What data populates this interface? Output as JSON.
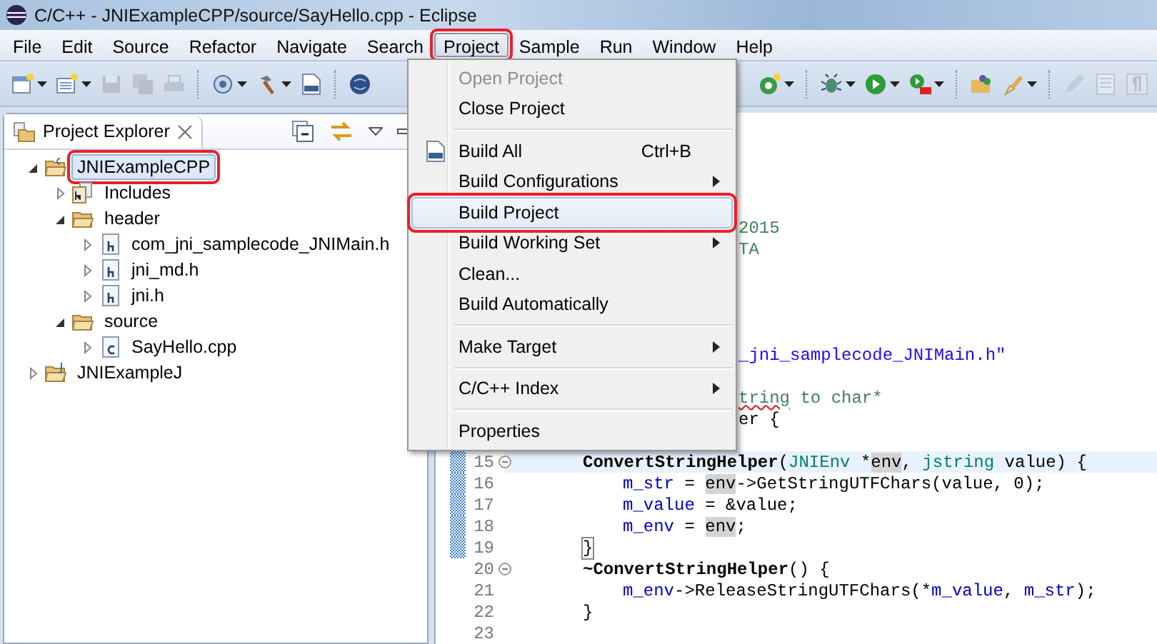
{
  "window": {
    "title": "C/C++ - JNIExampleCPP/source/SayHello.cpp - Eclipse"
  },
  "menu_bar": [
    {
      "label": "File",
      "selected": false,
      "callout": false
    },
    {
      "label": "Edit",
      "selected": false,
      "callout": false
    },
    {
      "label": "Source",
      "selected": false,
      "callout": false
    },
    {
      "label": "Refactor",
      "selected": false,
      "callout": false
    },
    {
      "label": "Navigate",
      "selected": false,
      "callout": false
    },
    {
      "label": "Search",
      "selected": false,
      "callout": false
    },
    {
      "label": "Project",
      "selected": true,
      "callout": true
    },
    {
      "label": "Sample",
      "selected": false,
      "callout": false
    },
    {
      "label": "Run",
      "selected": false,
      "callout": false
    },
    {
      "label": "Window",
      "selected": false,
      "callout": false
    },
    {
      "label": "Help",
      "selected": false,
      "callout": false
    }
  ],
  "toolbar_left": [
    {
      "kind": "new",
      "dropdown": true,
      "disabled": false
    },
    {
      "kind": "new-class",
      "dropdown": true,
      "disabled": false
    },
    {
      "kind": "save",
      "dropdown": false,
      "disabled": true
    },
    {
      "kind": "save-all",
      "dropdown": false,
      "disabled": true
    },
    {
      "kind": "print",
      "dropdown": false,
      "disabled": true
    },
    {
      "kind": "separator"
    },
    {
      "kind": "debug-config",
      "dropdown": true,
      "disabled": false
    },
    {
      "kind": "hammer",
      "dropdown": true,
      "disabled": false
    },
    {
      "kind": "binary",
      "dropdown": false,
      "disabled": false
    },
    {
      "kind": "separator"
    },
    {
      "kind": "globe",
      "dropdown": false,
      "disabled": false
    }
  ],
  "toolbar_right": [
    {
      "kind": "new-c",
      "dropdown": true,
      "disabled": false
    },
    {
      "kind": "separator"
    },
    {
      "kind": "bug",
      "dropdown": true,
      "disabled": false
    },
    {
      "kind": "run",
      "dropdown": true,
      "disabled": false
    },
    {
      "kind": "run-external",
      "dropdown": true,
      "disabled": false
    },
    {
      "kind": "separator"
    },
    {
      "kind": "open-folder",
      "dropdown": false,
      "disabled": false
    },
    {
      "kind": "brush",
      "dropdown": true,
      "disabled": false
    },
    {
      "kind": "separator"
    },
    {
      "kind": "pencil",
      "dropdown": false,
      "disabled": true
    },
    {
      "kind": "page",
      "dropdown": false,
      "disabled": true
    },
    {
      "kind": "pilcrow",
      "dropdown": false,
      "disabled": true
    }
  ],
  "project_explorer": {
    "title": "Project Explorer",
    "tree": [
      {
        "label": "JNIExampleCPP",
        "kind": "c-project",
        "expanded": true,
        "selected": true,
        "callout": true,
        "children": [
          {
            "label": "Includes",
            "kind": "includes",
            "expanded": false,
            "selected": false,
            "callout": false
          },
          {
            "label": "header",
            "kind": "folder",
            "expanded": true,
            "selected": false,
            "callout": false,
            "children": [
              {
                "label": "com_jni_samplecode_JNIMain.h",
                "kind": "header-file",
                "expanded": false,
                "selected": false,
                "callout": false
              },
              {
                "label": "jni_md.h",
                "kind": "header-file",
                "expanded": false,
                "selected": false,
                "callout": false
              },
              {
                "label": "jni.h",
                "kind": "header-file",
                "expanded": false,
                "selected": false,
                "callout": false
              }
            ]
          },
          {
            "label": "source",
            "kind": "folder",
            "expanded": true,
            "selected": false,
            "callout": false,
            "children": [
              {
                "label": "SayHello.cpp",
                "kind": "source-file",
                "expanded": false,
                "selected": false,
                "callout": false
              }
            ]
          }
        ]
      },
      {
        "label": "JNIExampleJ",
        "kind": "java-project",
        "expanded": false,
        "selected": false,
        "callout": false
      }
    ]
  },
  "project_menu": [
    {
      "kind": "item",
      "label": "Open Project",
      "disabled": true,
      "selected": false,
      "callout": false
    },
    {
      "kind": "item",
      "label": "Close Project",
      "disabled": false,
      "selected": false,
      "callout": false
    },
    {
      "kind": "separator"
    },
    {
      "kind": "icon-item",
      "label": "Build All",
      "shortcut": "Ctrl+B",
      "disabled": false,
      "selected": false,
      "callout": false
    },
    {
      "kind": "item",
      "label": "Build Configurations",
      "submenu": true,
      "disabled": false,
      "selected": false,
      "callout": false
    },
    {
      "kind": "item",
      "label": "Build Project",
      "disabled": false,
      "selected": true,
      "callout": true
    },
    {
      "kind": "item",
      "label": "Build Working Set",
      "submenu": true,
      "disabled": false,
      "selected": false,
      "callout": false
    },
    {
      "kind": "item",
      "label": "Clean...",
      "disabled": false,
      "selected": false,
      "callout": false
    },
    {
      "kind": "item",
      "label": "Build Automatically",
      "disabled": false,
      "selected": false,
      "callout": false
    },
    {
      "kind": "separator"
    },
    {
      "kind": "item",
      "label": "Make Target",
      "submenu": true,
      "disabled": false,
      "selected": false,
      "callout": false
    },
    {
      "kind": "separator"
    },
    {
      "kind": "item",
      "label": "C/C++ Index",
      "submenu": true,
      "disabled": false,
      "selected": false,
      "callout": false
    },
    {
      "kind": "separator"
    },
    {
      "kind": "item",
      "label": "Properties",
      "disabled": false,
      "selected": false,
      "callout": false
    }
  ],
  "editor": {
    "covered_lines": [
      {
        "kind": "blank"
      },
      {
        "kind": "blank"
      },
      {
        "kind": "blank"
      },
      {
        "kind": "fragment",
        "segments": [
          {
            "text": "2015",
            "kind": "comment"
          }
        ]
      },
      {
        "kind": "fragment",
        "segments": [
          {
            "text": "TA",
            "kind": "comment"
          }
        ]
      },
      {
        "kind": "blank"
      },
      {
        "kind": "blank"
      },
      {
        "kind": "blank"
      },
      {
        "kind": "blank"
      },
      {
        "kind": "fragment",
        "segments": [
          {
            "text": "_jni_samplecode_JNIMain.h\"",
            "kind": "string"
          }
        ]
      },
      {
        "kind": "blank"
      },
      {
        "kind": "fragment",
        "segments": [
          {
            "text": "tring",
            "kind": "comment-typo"
          },
          {
            "text": " to char*",
            "kind": "comment"
          }
        ]
      },
      {
        "kind": "fragment",
        "segments": [
          {
            "text": "er {",
            "kind": "plain"
          }
        ]
      },
      {
        "kind": "blank"
      }
    ],
    "lines": [
      {
        "number": "15",
        "fold": true,
        "changed": true,
        "current": true,
        "segments": [
          {
            "text": "ConvertStringHelper",
            "kind": "bold"
          },
          {
            "text": "(",
            "kind": "plain"
          },
          {
            "text": "JNIEnv",
            "kind": "type"
          },
          {
            "text": " *",
            "kind": "plain"
          },
          {
            "text": "env",
            "kind": "mark"
          },
          {
            "text": ", ",
            "kind": "plain"
          },
          {
            "text": "jstring",
            "kind": "type"
          },
          {
            "text": " value) {",
            "kind": "plain"
          }
        ],
        "children": [
          {
            "number": "16",
            "fold": false,
            "changed": true,
            "current": false,
            "segments": [
              {
                "text": "m_str",
                "kind": "field"
              },
              {
                "text": " = ",
                "kind": "plain"
              },
              {
                "text": "env",
                "kind": "mark"
              },
              {
                "text": "->GetStringUTFChars(value, 0);",
                "kind": "plain"
              }
            ]
          },
          {
            "number": "17",
            "fold": false,
            "changed": true,
            "current": false,
            "segments": [
              {
                "text": "m_value",
                "kind": "field"
              },
              {
                "text": " = &value;",
                "kind": "plain"
              }
            ]
          },
          {
            "number": "18",
            "fold": false,
            "changed": true,
            "current": false,
            "segments": [
              {
                "text": "m_env",
                "kind": "field"
              },
              {
                "text": " = ",
                "kind": "plain"
              },
              {
                "text": "env",
                "kind": "mark"
              },
              {
                "text": ";",
                "kind": "plain"
              }
            ]
          }
        ]
      },
      {
        "number": "19",
        "fold": false,
        "changed": true,
        "current": false,
        "segments": [
          {
            "text": "}",
            "kind": "bracket-match"
          }
        ]
      },
      {
        "number": "20",
        "fold": true,
        "changed": false,
        "current": false,
        "segments": [
          {
            "text": "~ConvertStringHelper",
            "kind": "bold"
          },
          {
            "text": "() {",
            "kind": "plain"
          }
        ],
        "children": [
          {
            "number": "21",
            "fold": false,
            "changed": false,
            "current": false,
            "segments": [
              {
                "text": "m_env",
                "kind": "field"
              },
              {
                "text": "->ReleaseStringUTFChars(*",
                "kind": "plain"
              },
              {
                "text": "m_value",
                "kind": "field"
              },
              {
                "text": ", ",
                "kind": "plain"
              },
              {
                "text": "m_str",
                "kind": "field"
              },
              {
                "text": ");",
                "kind": "plain"
              }
            ]
          }
        ]
      },
      {
        "number": "22",
        "fold": false,
        "changed": false,
        "current": false,
        "segments": [
          {
            "text": "}",
            "kind": "plain"
          }
        ]
      },
      {
        "number": "23",
        "fold": false,
        "changed": false,
        "current": false
      }
    ]
  }
}
